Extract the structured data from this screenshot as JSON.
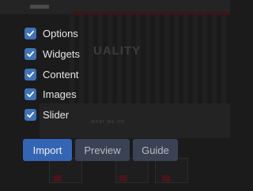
{
  "options": [
    {
      "label": "Options",
      "checked": true
    },
    {
      "label": "Widgets",
      "checked": true
    },
    {
      "label": "Content",
      "checked": true
    },
    {
      "label": "Images",
      "checked": true
    },
    {
      "label": "Slider",
      "checked": true
    }
  ],
  "buttons": {
    "import": "Import",
    "preview": "Preview",
    "guide": "Guide"
  },
  "background": {
    "hero_text": "UALITY",
    "section_text": "WHAT WE DO"
  },
  "colors": {
    "checkbox": "#3f73b8",
    "primary_button": "#3465b4",
    "secondary_button": "#3a4253",
    "overlay_background": "#1b1b1b"
  }
}
